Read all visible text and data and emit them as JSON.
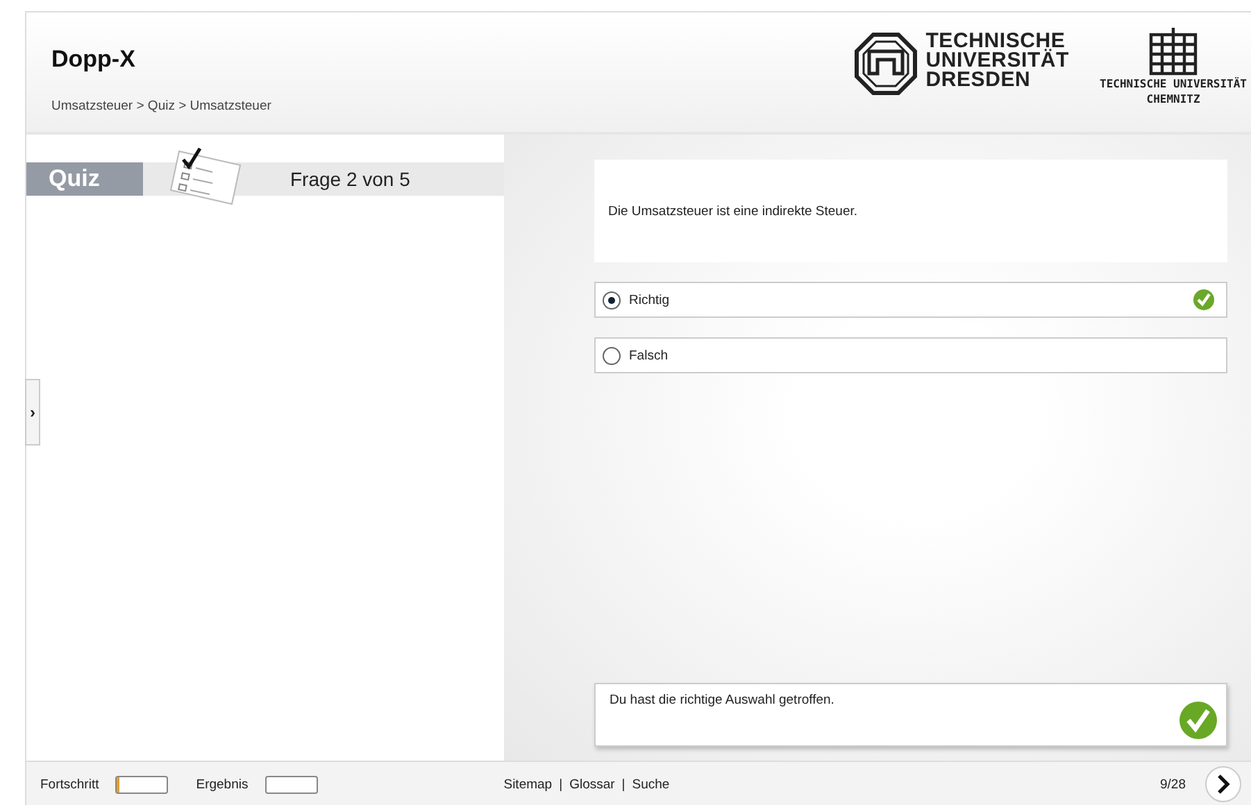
{
  "header": {
    "title": "Dopp-X",
    "breadcrumb": "Umsatzsteuer > Quiz > Umsatzsteuer",
    "logo_dresden": [
      "TECHNISCHE",
      "UNIVERSITÄT",
      "DRESDEN"
    ],
    "logo_chemnitz": [
      "TECHNISCHE UNIVERSITÄT",
      "CHEMNITZ"
    ]
  },
  "sidebar": {
    "label": "Quiz",
    "counter": "Frage 2 von 5",
    "toggle": "›"
  },
  "question": "Die Umsatzsteuer ist eine indirekte Steuer.",
  "options": [
    {
      "label": "Richtig",
      "selected": true,
      "correct": true
    },
    {
      "label": "Falsch",
      "selected": false,
      "correct": false
    }
  ],
  "feedback": {
    "text": "Du hast die richtige Auswahl getroffen.",
    "correct": true
  },
  "footer": {
    "progress_label": "Fortschritt",
    "progress": {
      "level": 0.05
    },
    "result_label": "Ergebnis",
    "result": {
      "level": 0
    },
    "links": [
      "Sitemap",
      "Glossar",
      "Suche"
    ],
    "separator": "|",
    "page": "9/28"
  }
}
